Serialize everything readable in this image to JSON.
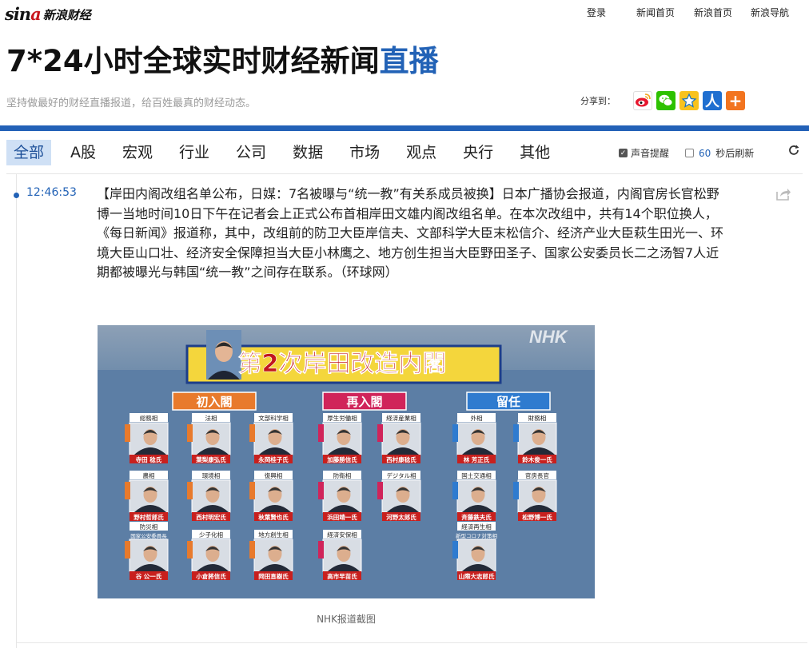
{
  "header": {
    "logo_mark": "sina",
    "logo_text": "新浪财经",
    "links": [
      "登录",
      "新闻首页",
      "新浪首页",
      "新浪导航"
    ]
  },
  "title": {
    "main": "7*24小时全球实时财经新闻",
    "highlight": "直播"
  },
  "subtitle": "坚持做最好的财经直播报道，给百姓最真的财经动态。",
  "share": {
    "label": "分享到：",
    "icons": [
      "weibo-icon",
      "wechat-icon",
      "qzone-icon",
      "renren-icon",
      "more-icon"
    ]
  },
  "nav": {
    "tabs": [
      "全部",
      "A股",
      "宏观",
      "行业",
      "公司",
      "数据",
      "市场",
      "观点",
      "央行",
      "其他"
    ],
    "sound_label": "声音提醒",
    "interval": "60",
    "refresh_label": "秒后刷新"
  },
  "feed": [
    {
      "time": "12:46:53",
      "text": "【岸田内阁改组名单公布，日媒：7名被曝与“统一教”有关系成员被换】日本广播协会报道，内阁官房长官松野博一当地时间10日下午在记者会上正式公布首相岸田文雄内阁改组名单。在本次改组中，共有14个职位换人，《每日新闻》报道称，其中，改组前的防卫大臣岸信夫、文部科学大臣末松信介、经济产业大臣萩生田光一、环境大臣山口壮、经济安全保障担当大臣小林鹰之、地方创生担当大臣野田圣子、国家公安委员长二之汤智7人近期都被曝光与韩国“统一教”之间存在联系。（环球网）",
      "image": {
        "banner": "第2次岸田改造内閣",
        "watermark": "NHK",
        "groups": [
          {
            "label": "初入閣",
            "members": [
              {
                "post": "総務相",
                "name": "寺田 稔氏"
              },
              {
                "post": "法相",
                "name": "葉梨康弘氏"
              },
              {
                "post": "文部科学相",
                "name": "永岡桂子氏"
              },
              {
                "post": "農相",
                "name": "野村哲郎氏"
              },
              {
                "post": "環境相",
                "name": "西村明宏氏"
              },
              {
                "post": "復興相",
                "name": "秋葉賢也氏"
              },
              {
                "post": "防災相",
                "post2": "国家公安委員長",
                "name": "谷 公一氏"
              },
              {
                "post": "少子化相",
                "name": "小倉將信氏"
              },
              {
                "post": "地方創生相",
                "name": "岡田直樹氏"
              }
            ]
          },
          {
            "label": "再入閣",
            "members": [
              {
                "post": "厚生労働相",
                "name": "加藤勝信氏"
              },
              {
                "post": "経済産業相",
                "name": "西村康稔氏"
              },
              {
                "post": "防衛相",
                "name": "浜田靖一氏"
              },
              {
                "post": "デジタル相",
                "name": "河野太郎氏"
              },
              {
                "post": "経済安保相",
                "name": "高市早苗氏"
              }
            ]
          },
          {
            "label": "留任",
            "members": [
              {
                "post": "外相",
                "name": "林 芳正氏"
              },
              {
                "post": "財務相",
                "name": "鈴木俊一氏"
              },
              {
                "post": "国土交通相",
                "name": "斉藤鉄夫氏"
              },
              {
                "post": "官房長官",
                "name": "松野博一氏"
              },
              {
                "post": "経済再生相",
                "post2": "新型コロナ対策相",
                "name": "山際大志郎氏"
              }
            ]
          }
        ]
      },
      "caption": "NHK报道截图"
    }
  ],
  "colors": {
    "brand_blue": "#2262b6",
    "bar_blue": "#2361b7",
    "active_tab_bg": "#cfe0f5",
    "banner_yellow": "#f4d63c",
    "label_orange": "#e87a2c",
    "label_pink": "#d0245a",
    "label_blue": "#2f7bcf",
    "name_red": "#c8201e"
  }
}
